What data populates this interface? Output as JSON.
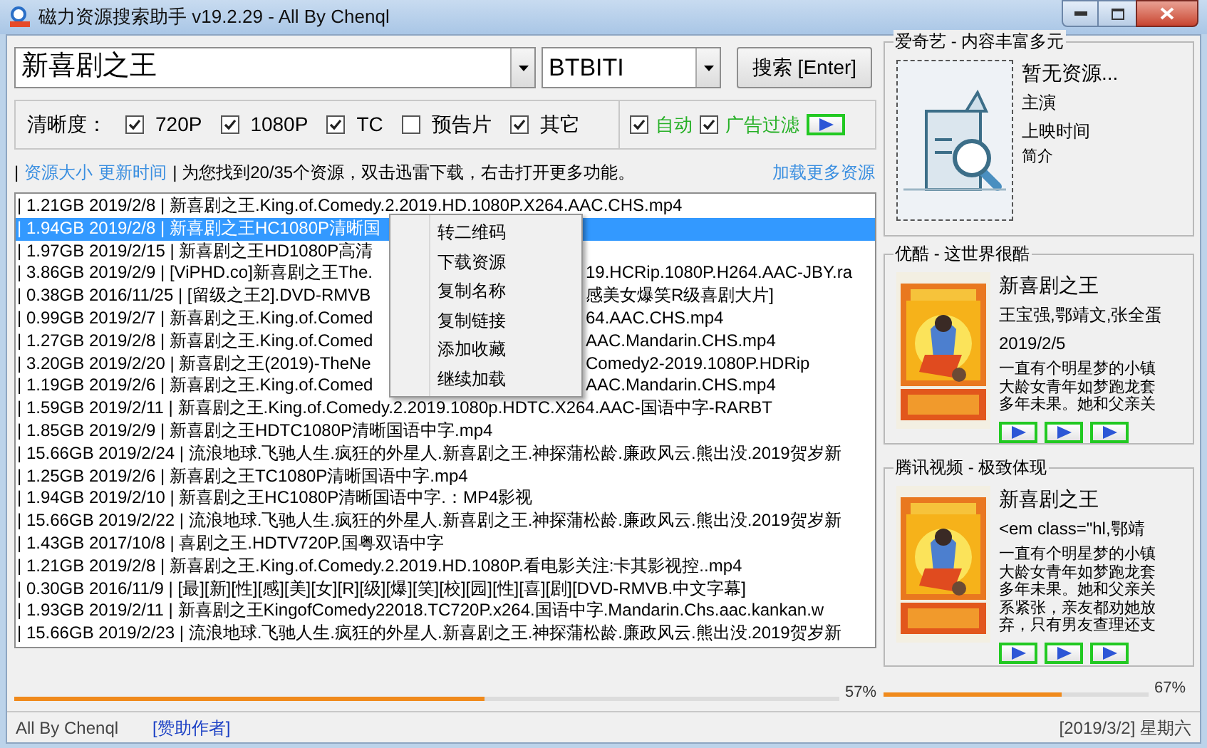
{
  "window": {
    "title": "磁力资源搜索助手 v19.2.29 - All By Chenql"
  },
  "search": {
    "query": "新喜剧之王",
    "engine": "BTBITI",
    "button": "搜索 [Enter]"
  },
  "filters": {
    "label": "清晰度：",
    "options": [
      {
        "label": "720P",
        "checked": true
      },
      {
        "label": "1080P",
        "checked": true
      },
      {
        "label": "TC",
        "checked": true
      },
      {
        "label": "预告片",
        "checked": false
      },
      {
        "label": "其它",
        "checked": true
      }
    ],
    "toggles": [
      {
        "label": "自动",
        "checked": true
      },
      {
        "label": "广告过滤",
        "checked": true
      }
    ]
  },
  "info": {
    "lead": "|",
    "sort_links": [
      "资源大小",
      "更新时间"
    ],
    "message": "| 为您找到20/35个资源，双击迅雷下载，右击打开更多功能。",
    "more_link": "加载更多资源"
  },
  "results": [
    {
      "text": "| 1.21GB 2019/2/8 | 新喜剧之王.King.of.Comedy.2.2019.HD.1080P.X264.AAC.CHS.mp4",
      "selected": false
    },
    {
      "text": "| 1.94GB 2019/2/8 | 新喜剧之王HC1080P清晰国",
      "selected": true
    },
    {
      "text": "| 1.97GB 2019/2/15 | 新喜剧之王HD1080P高清",
      "selected": false
    },
    {
      "text": "| 3.86GB 2019/2/9 | [ViPHD.co]新喜剧之王The.",
      "text_after_menu": "19.HCRip.1080P.H264.AAC-JBY.ra",
      "selected": false
    },
    {
      "text": "| 0.38GB 2016/11/25 | [留级之王2].DVD-RMVB",
      "text_after_menu": "感美女爆笑R级喜剧大片]",
      "selected": false
    },
    {
      "text": "| 0.99GB 2019/2/7 | 新喜剧之王.King.of.Comed",
      "text_after_menu": "64.AAC.CHS.mp4",
      "selected": false
    },
    {
      "text": "| 1.27GB 2019/2/8 | 新喜剧之王.King.of.Comed",
      "text_after_menu": "AAC.Mandarin.CHS.mp4",
      "selected": false
    },
    {
      "text": "| 3.20GB 2019/2/20 | 新喜剧之王(2019)-TheNe",
      "text_after_menu": "Comedy2-2019.1080P.HDRip",
      "selected": false
    },
    {
      "text": "| 1.19GB 2019/2/6 | 新喜剧之王.King.of.Comed",
      "text_after_menu": "AAC.Mandarin.CHS.mp4",
      "selected": false
    },
    {
      "text": "| 1.59GB 2019/2/11 | 新喜剧之王.King.of.Comedy.2.2019.1080p.HDTC.X264.AAC-国语中字-RARBT",
      "selected": false
    },
    {
      "text": "| 1.85GB 2019/2/9 | 新喜剧之王HDTC1080P清晰国语中字.mp4",
      "selected": false
    },
    {
      "text": "| 15.66GB 2019/2/24 | 流浪地球.飞驰人生.疯狂的外星人.新喜剧之王.神探蒲松龄.廉政风云.熊出没.2019贺岁新",
      "selected": false
    },
    {
      "text": "| 1.25GB 2019/2/6 | 新喜剧之王TC1080P清晰国语中字.mp4",
      "selected": false
    },
    {
      "text": "| 1.94GB 2019/2/10 | 新喜剧之王HC1080P清晰国语中字.：MP4影视",
      "selected": false
    },
    {
      "text": "| 15.66GB 2019/2/22 | 流浪地球.飞驰人生.疯狂的外星人.新喜剧之王.神探蒲松龄.廉政风云.熊出没.2019贺岁新",
      "selected": false
    },
    {
      "text": "| 1.43GB 2017/10/8 | 喜剧之王.HDTV720P.国粤双语中字",
      "selected": false
    },
    {
      "text": "| 1.21GB 2019/2/8 | 新喜剧之王.King.of.Comedy.2.2019.HD.1080P.看电影关注:卡其影视控..mp4",
      "selected": false
    },
    {
      "text": "| 0.30GB 2016/11/9 | [最][新][性][感][美][女][R][级][爆][笑][校][园][性][喜][剧][DVD-RMVB.中文字幕]",
      "selected": false
    },
    {
      "text": "| 1.93GB 2019/2/11 | 新喜剧之王KingofComedy22018.TC720P.x264.国语中字.Mandarin.Chs.aac.kankan.w",
      "selected": false
    },
    {
      "text": "| 15.66GB 2019/2/23 | 流浪地球.飞驰人生.疯狂的外星人.新喜剧之王.神探蒲松龄.廉政风云.熊出没.2019贺岁新",
      "selected": false
    }
  ],
  "context_menu": [
    "转二维码",
    "下载资源",
    "复制名称",
    "复制链接",
    "添加收藏",
    "继续加载"
  ],
  "progress_left": {
    "level": 0.57,
    "reading": "57%"
  },
  "sources": [
    {
      "title": "爱奇艺 - 内容丰富多元",
      "kind": "placeholder",
      "name": "暂无资源...",
      "actors": "主演",
      "date": "上映时间",
      "summary": "简介"
    },
    {
      "title": "优酷 - 这世界很酷",
      "kind": "poster",
      "name": "新喜剧之王",
      "actors": "王宝强,鄂靖文,张全蛋",
      "date": "2019/2/5",
      "summary": "一直有个明星梦的小镇大龄女青年如梦跑龙套多年未果。她和父亲关"
    },
    {
      "title": "腾讯视频 - 极致体现",
      "kind": "poster",
      "name": "新喜剧之王",
      "actors": "<em class=\"hl,鄂靖",
      "summary": "一直有个明星梦的小镇大龄女青年如梦跑龙套多年未果。她和父亲关系紧张，亲友都劝她放弃，只有男友查理还支"
    }
  ],
  "progress_right": {
    "level": 0.67,
    "reading": "67%"
  },
  "status_bar": {
    "author": "All By Chenql",
    "sponsor_link": "[赞助作者]",
    "date": "[2019/3/2] 星期六"
  }
}
